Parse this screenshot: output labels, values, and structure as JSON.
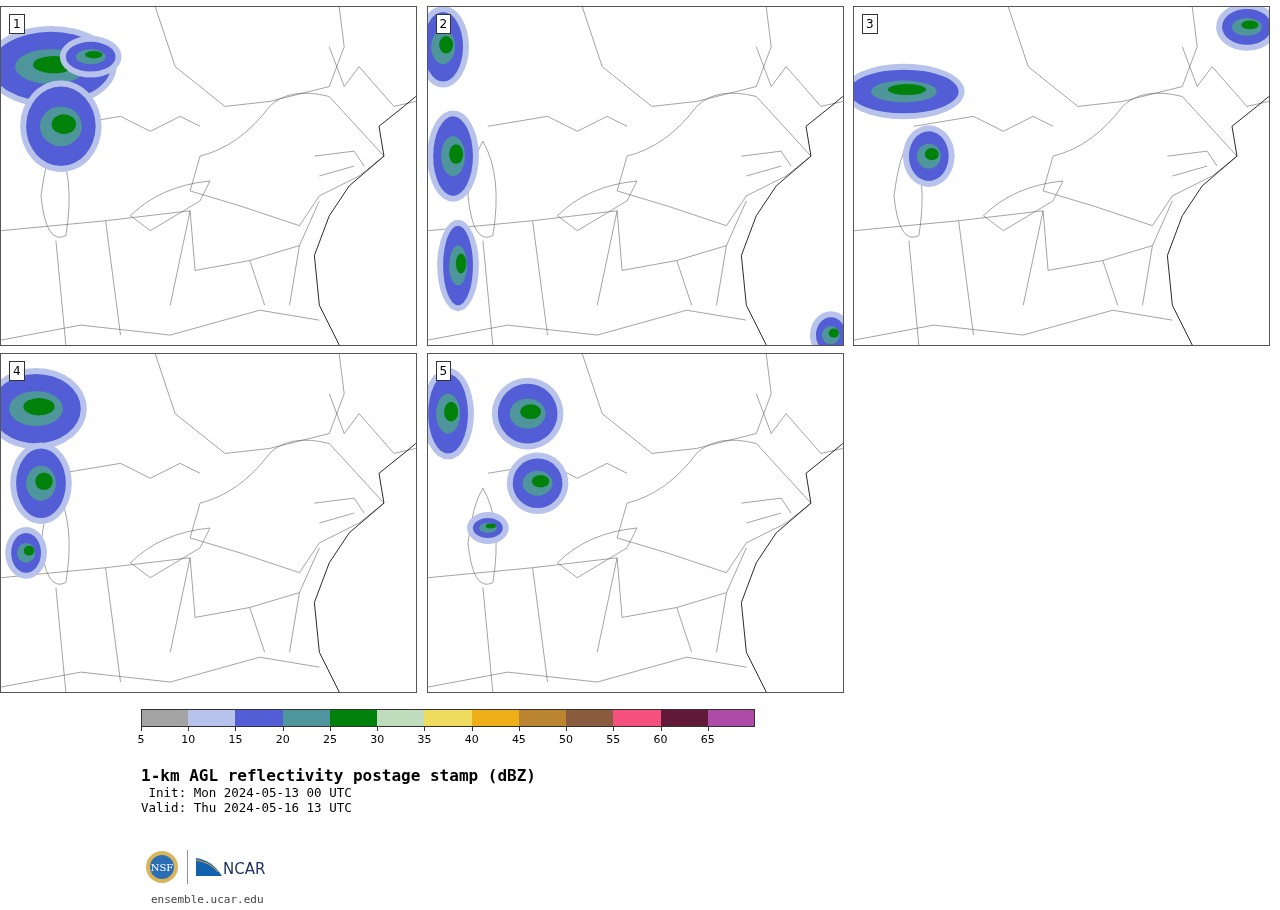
{
  "panels": [
    {
      "label": "1"
    },
    {
      "label": "2"
    },
    {
      "label": "3"
    },
    {
      "label": "4"
    },
    {
      "label": "5"
    }
  ],
  "colorbar": {
    "segments": [
      {
        "color": "#a3a3a3",
        "label": "5"
      },
      {
        "color": "#b8c3ec",
        "label": "10"
      },
      {
        "color": "#525dd6",
        "label": "15"
      },
      {
        "color": "#4f969c",
        "label": "20"
      },
      {
        "color": "#00820a",
        "label": "25"
      },
      {
        "color": "#bfdcbc",
        "label": "30"
      },
      {
        "color": "#efdb5e",
        "label": "35"
      },
      {
        "color": "#eeae18",
        "label": "40"
      },
      {
        "color": "#bb8431",
        "label": "45"
      },
      {
        "color": "#8a5b3f",
        "label": "50"
      },
      {
        "color": "#f5517f",
        "label": "55"
      },
      {
        "color": "#621838",
        "label": "60"
      },
      {
        "color": "#ae4ba6",
        "label": "65"
      }
    ]
  },
  "title": "1-km AGL reflectivity postage stamp (dBZ)",
  "init": " Init: Mon 2024-05-13 00 UTC",
  "valid": "Valid: Thu 2024-05-16 13 UTC",
  "logos": {
    "nsf": "NSF",
    "ncar": "NCAR"
  },
  "url": "ensemble.ucar.edu"
}
